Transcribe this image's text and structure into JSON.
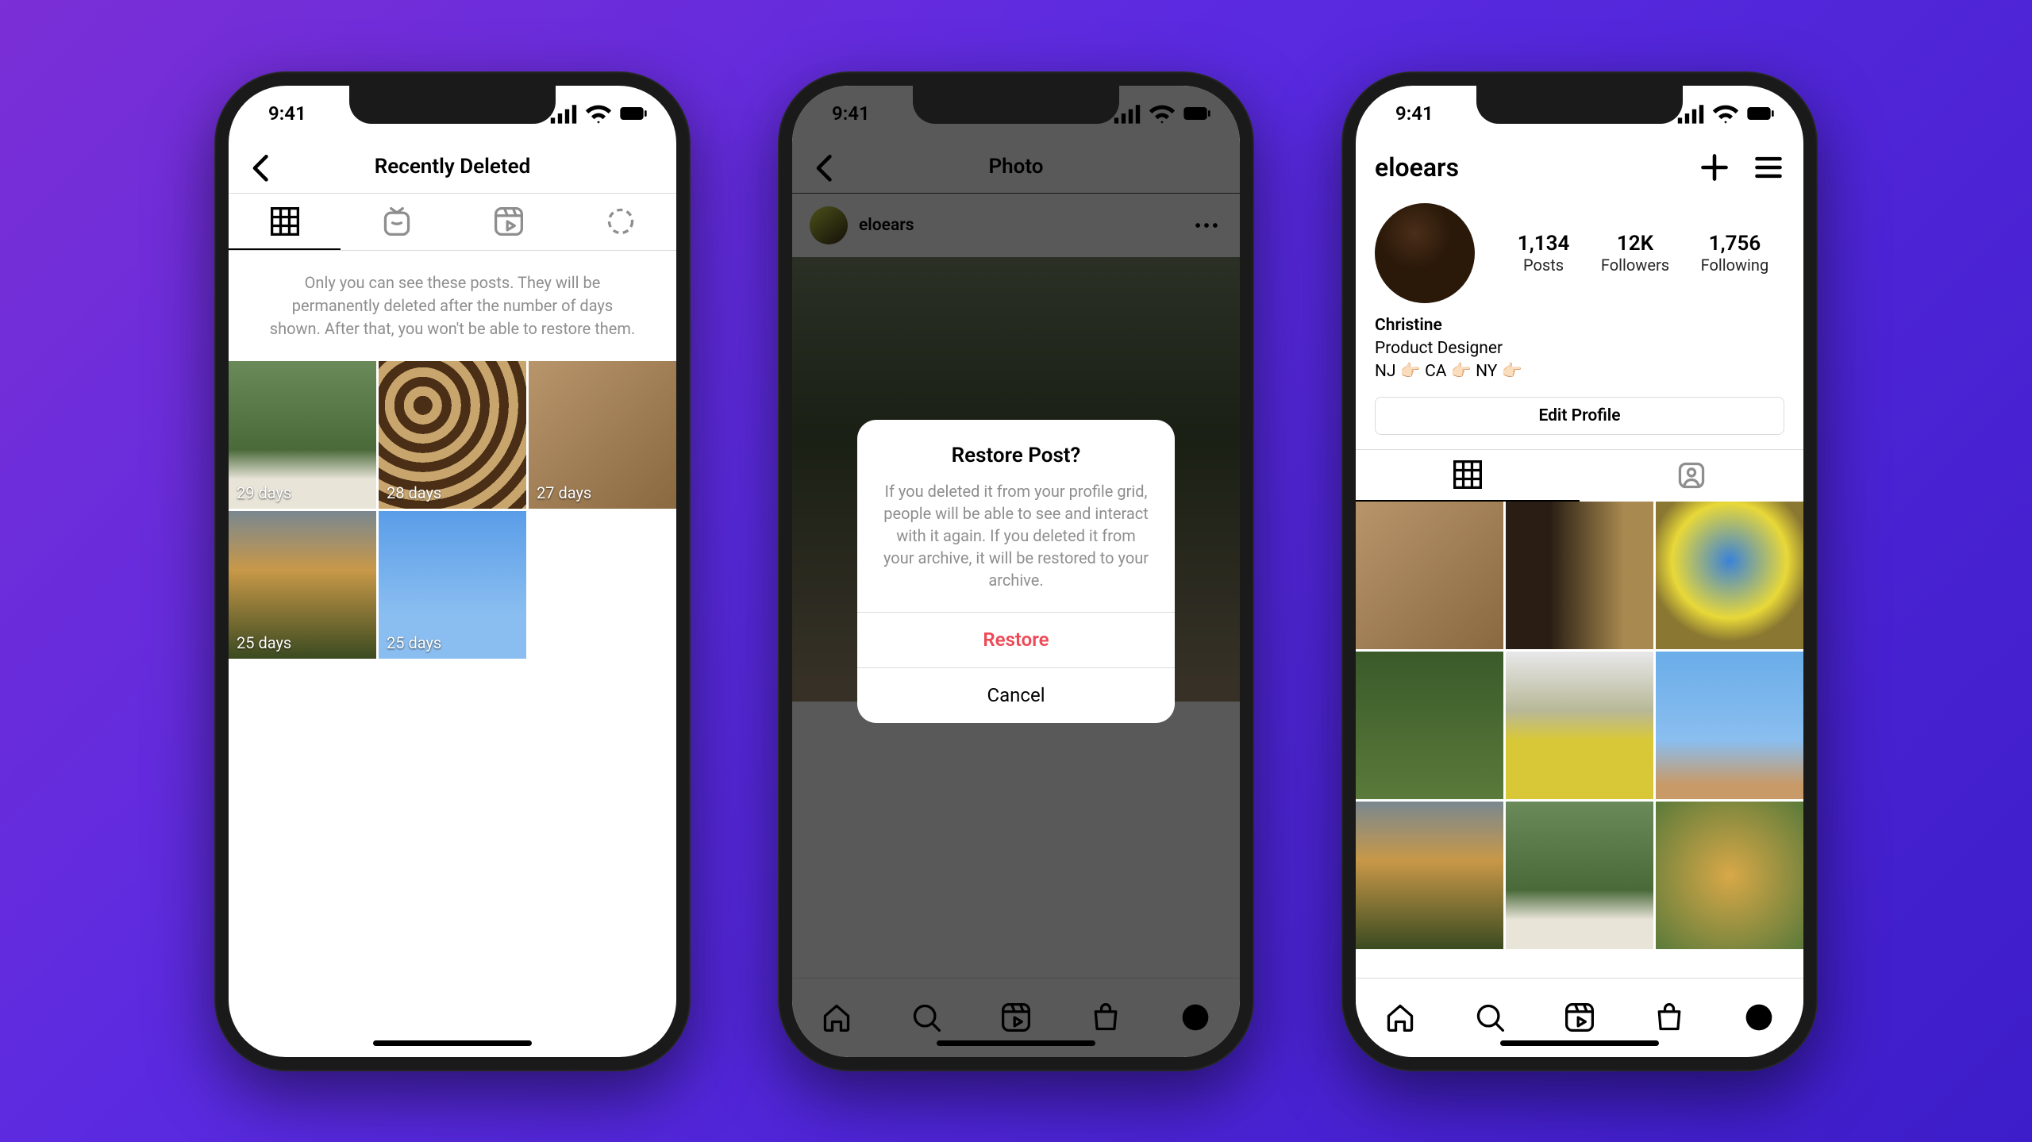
{
  "status": {
    "time": "9:41"
  },
  "phone1": {
    "title": "Recently Deleted",
    "info": "Only you can see these posts. They will be permanently deleted after the number of days shown. After that, you won't be able to restore them.",
    "items": [
      {
        "label": "29 days"
      },
      {
        "label": "28 days"
      },
      {
        "label": "27 days"
      },
      {
        "label": "25 days"
      },
      {
        "label": "25 days"
      }
    ]
  },
  "phone2": {
    "title": "Photo",
    "username": "eloears",
    "dialog": {
      "title": "Restore Post?",
      "body": "If you deleted it from your profile grid, people will be able to see and interact with it again. If you deleted it from your archive, it will be restored to your archive.",
      "restore": "Restore",
      "cancel": "Cancel"
    }
  },
  "phone3": {
    "username": "eloears",
    "stats": {
      "posts_n": "1,134",
      "posts_l": "Posts",
      "followers_n": "12K",
      "followers_l": "Followers",
      "following_n": "1,756",
      "following_l": "Following"
    },
    "bio": {
      "name": "Christine",
      "line1": "Product Designer",
      "line2": "NJ 👉🏻 CA 👉🏻 NY 👉🏻"
    },
    "edit": "Edit Profile"
  }
}
